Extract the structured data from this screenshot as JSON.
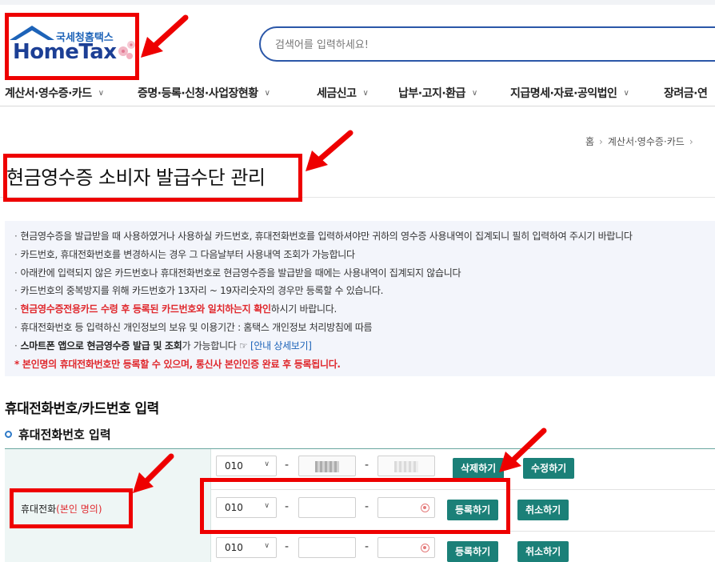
{
  "header": {
    "logo_sub": "국세청홈택스",
    "logo_main": "HomeTax",
    "search_placeholder": "검색어를 입력하세요!"
  },
  "nav": {
    "items": [
      {
        "label": "계산서·영수증·카드"
      },
      {
        "label": "증명·등록·신청·사업장현황"
      },
      {
        "label": "세금신고"
      },
      {
        "label": "납부·고지·환급"
      },
      {
        "label": "지급명세·자료·공익법인"
      },
      {
        "label": "장려금·연"
      }
    ]
  },
  "breadcrumb": {
    "home": "홈",
    "level1": "계산서·영수증·카드"
  },
  "page_title": "현금영수증 소비자 발급수단 관리",
  "info": {
    "line1": "현금영수증을 발급받을 때 사용하였거나 사용하실 카드번호, 휴대전화번호를 입력하셔야만 귀하의 영수증 사용내역이 집계되니 필히 입력하여 주시기 바랍니다",
    "line2": "카드번호, 휴대전화번호를 변경하시는 경우 그 다음날부터 사용내역 조회가 가능합니다",
    "line3": "아래칸에 입력되지 않은 카드번호나 휴대전화번호로 현금영수증을 발급받을 때에는 사용내역이 집계되지 않습니다",
    "line4": "카드번호의 중복방지를 위해 카드번호가 13자리 ~ 19자리숫자의 경우만 등록할 수 있습니다.",
    "line5_red": "현금영수증전용카드 수령 후 등록된 카드번호와 일치하는지 확인",
    "line5_rest": "하시기 바랍니다.",
    "line6": "휴대전화번호 등 입력하신 개인정보의 보유 및 이용기간 : 홈택스 개인정보 처리방침에 따름",
    "line7_bold": "스마트폰 앱으로 현금영수증 발급 및 조회",
    "line7_rest": "가 가능합니다 ☞ ",
    "line7_link": "[안내 상세보기]",
    "line8_red": "* 본인명의 휴대전화번호만 등록할 수 있으며, 통신사 본인인증 완료 후 등록됩니다."
  },
  "section_title": "휴대전화번호/카드번호 입력",
  "sub_title": "휴대전화번호 입력",
  "form": {
    "label": "휴대전화",
    "label_note": "(본인 명의)",
    "rows": [
      {
        "prefix": "010",
        "dash": "-",
        "buttons": [
          "삭제하기",
          "수정하기"
        ]
      },
      {
        "prefix": "010",
        "dash": "-",
        "buttons": [
          "등록하기",
          "취소하기"
        ]
      },
      {
        "prefix": "010",
        "dash": "-",
        "buttons": [
          "등록하기",
          "취소하기"
        ]
      }
    ]
  },
  "colors": {
    "brand_blue": "#1c3f95",
    "button_teal": "#1b8078",
    "annotation_red": "#ee0000",
    "notice_red": "#e0282d"
  }
}
